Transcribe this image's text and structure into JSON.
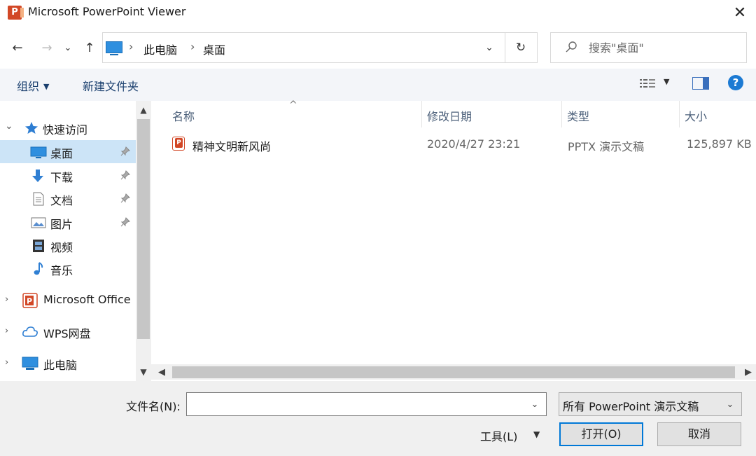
{
  "window": {
    "title": "Microsoft PowerPoint Viewer",
    "app_icon_letter": "P",
    "close_glyph": "✕"
  },
  "navigation": {
    "back_glyph": "←",
    "forward_glyph": "→",
    "recent_glyph": "⌄",
    "up_glyph": "↑",
    "breadcrumb": [
      "此电脑",
      "桌面"
    ],
    "breadcrumb_separator": "›",
    "dropdown_glyph": "⌄",
    "refresh_glyph": "↻"
  },
  "search": {
    "placeholder": "搜索\"桌面\""
  },
  "toolbar": {
    "organize_label": "组织",
    "organize_arrow": "▼",
    "new_folder_label": "新建文件夹",
    "view_arrow": "▼",
    "help_glyph": "?"
  },
  "nav_pane": {
    "quick_access": "快速访问",
    "items": [
      {
        "label": "桌面",
        "icon": "desktop-icon",
        "pinned": true,
        "selected": true
      },
      {
        "label": "下载",
        "icon": "download-icon",
        "pinned": true,
        "selected": false
      },
      {
        "label": "文档",
        "icon": "document-icon",
        "pinned": true,
        "selected": false
      },
      {
        "label": "图片",
        "icon": "picture-icon",
        "pinned": true,
        "selected": false
      },
      {
        "label": "视频",
        "icon": "video-icon",
        "pinned": false,
        "selected": false
      },
      {
        "label": "音乐",
        "icon": "music-icon",
        "pinned": false,
        "selected": false
      }
    ],
    "groups": [
      {
        "label": "Microsoft Office",
        "icon": "powerpoint-icon"
      },
      {
        "label": "WPS网盘",
        "icon": "cloud-icon"
      },
      {
        "label": "此电脑",
        "icon": "computer-icon"
      }
    ],
    "expand_glyph": "›",
    "collapse_glyph": "⌄"
  },
  "file_list": {
    "columns": [
      "名称",
      "修改日期",
      "类型",
      "大小"
    ],
    "sort_glyph": "^",
    "rows": [
      {
        "name": "精神文明新风尚",
        "modified": "2020/4/27 23:21",
        "type": "PPTX 演示文稿",
        "size": "125,897 KB",
        "icon": "pptx-file-icon"
      }
    ]
  },
  "footer": {
    "filename_label": "文件名(N):",
    "filename_value": "",
    "filetype_value": "所有 PowerPoint 演示文稿",
    "tools_label": "工具(L)",
    "tools_arrow": "▼",
    "open_label": "打开(O)",
    "cancel_label": "取消"
  },
  "colors": {
    "accent": "#0078d7",
    "selection": "#cce4f7",
    "toolbar_bg": "#f3f5f9",
    "powerpoint": "#d24726",
    "help": "#1c7ad3"
  }
}
